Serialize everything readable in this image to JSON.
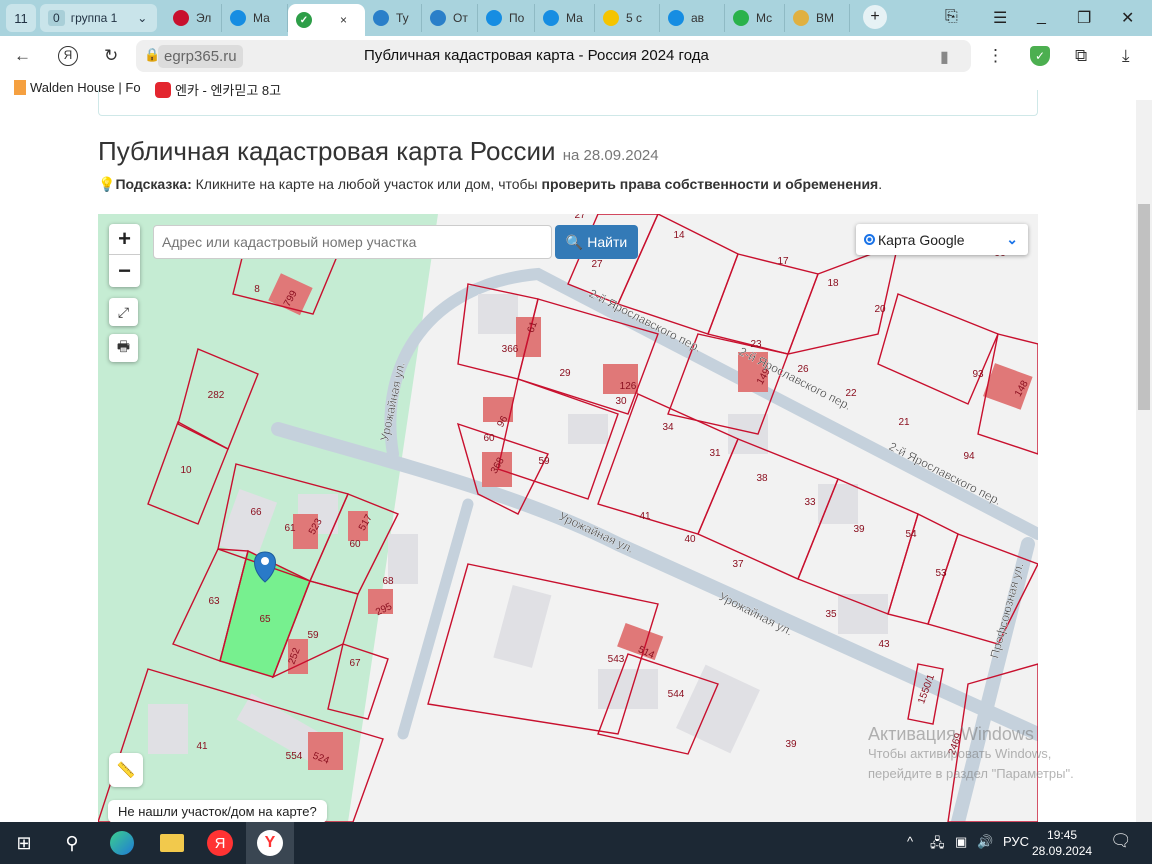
{
  "browser": {
    "tab_counter": "11",
    "group": {
      "count": "0",
      "label": "группа 1"
    },
    "tabs": [
      {
        "label": "Эл",
        "icon": "building-icon",
        "color": "#c8102e"
      },
      {
        "label": "Ма",
        "icon": "at-icon",
        "color": "#168de2"
      },
      {
        "label": "",
        "icon": "check-icon",
        "color": "#2e9e48",
        "active": true,
        "close": "×"
      },
      {
        "label": "Ту",
        "icon": "bird-icon",
        "color": "#2a7fc9"
      },
      {
        "label": "От",
        "icon": "bird-icon",
        "color": "#2a7fc9"
      },
      {
        "label": "По",
        "icon": "mail-icon",
        "color": "#168de2"
      },
      {
        "label": "Ма",
        "icon": "at-icon",
        "color": "#168de2"
      },
      {
        "label": "5 с",
        "icon": "play-icon",
        "color": "#f5c400"
      },
      {
        "label": "ав",
        "icon": "at-icon",
        "color": "#168de2"
      },
      {
        "label": "Мс",
        "icon": "dots-icon",
        "color": "#2ab24b"
      },
      {
        "label": "ВМ",
        "icon": "crown-icon",
        "color": "#e0b040"
      }
    ],
    "new_tab": "+",
    "domain": "egrp365.ru",
    "page_title": "Публичная кадастровая карта - Россия 2024 года",
    "bookmarks": [
      {
        "label": "Walden House | Fo"
      },
      {
        "label": "엔카 - 엔카믿고 8고"
      }
    ]
  },
  "page": {
    "title": "Публичная кадастровая карта России",
    "date": "на 28.09.2024",
    "hint_label": "Подсказка:",
    "hint_text": " Кликните на карте на любой участок или дом, чтобы ",
    "hint_bold": "проверить права собственности и обременения",
    "hint_end": "."
  },
  "map": {
    "zoom_in": "+",
    "zoom_out": "−",
    "search_placeholder": "Адрес или кадастровый номер участка",
    "find_label": "Найти",
    "layer": "Карта Google",
    "not_found": "Не нашли участок/дом на карте?",
    "selected_parcel": "65",
    "colors": {
      "parcel": "#c8102e",
      "building": "#e07878",
      "green": "#c5ecd3",
      "selected": "#77f08f",
      "road": "#c5d1dc"
    },
    "parcel_labels": [
      "27",
      "14",
      "27",
      "17",
      "18",
      "20",
      "96",
      "8",
      "799",
      "61",
      "366",
      "29",
      "126",
      "23",
      "149",
      "26",
      "22",
      "93",
      "148",
      "282",
      "30",
      "34",
      "21",
      "94",
      "60",
      "96",
      "368",
      "59",
      "31",
      "38",
      "10",
      "66",
      "61",
      "523",
      "517",
      "60",
      "33",
      "41",
      "40",
      "39",
      "54",
      "53",
      "37",
      "68",
      "295",
      "63",
      "65",
      "59",
      "252",
      "67",
      "35",
      "43",
      "543",
      "514",
      "544",
      "1550/1",
      "41",
      "554",
      "524",
      "39",
      "2469"
    ],
    "streets": [
      "2-й Ярославского пер.",
      "2-й Ярославского пер.",
      "2-й Ярославского пер.",
      "Урожайная ул.",
      "Урожайная ул.",
      "Урожайная ул.",
      "Профсоюзная ул."
    ]
  },
  "windows_watermark": {
    "title": "Активация Windows",
    "line1": "Чтобы активировать Windows,",
    "line2": "перейдите в раздел \"Параметры\"."
  },
  "taskbar": {
    "language": "РУС",
    "time": "19:45",
    "date": "28.09.2024"
  }
}
